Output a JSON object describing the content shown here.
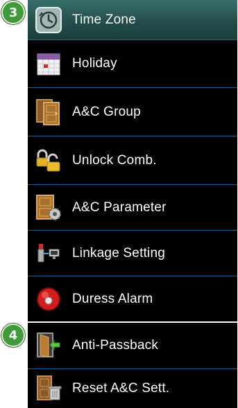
{
  "steps": {
    "first": "3",
    "second": "4"
  },
  "menu": {
    "items": [
      {
        "label": "Time Zone",
        "icon": "clock-icon",
        "selected": true
      },
      {
        "label": "Holiday",
        "icon": "calendar-icon"
      },
      {
        "label": "A&C Group",
        "icon": "double-door-icon"
      },
      {
        "label": "Unlock Comb.",
        "icon": "padlock-pair-icon"
      },
      {
        "label": "A&C Parameter",
        "icon": "door-gear-icon"
      },
      {
        "label": "Linkage Setting",
        "icon": "linkage-icon"
      },
      {
        "label": "Duress Alarm",
        "icon": "alarm-bell-icon"
      },
      {
        "label": "Anti-Passback",
        "icon": "door-arrow-icon"
      },
      {
        "label": "Reset A&C Sett.",
        "icon": "door-trash-icon"
      }
    ]
  },
  "colors": {
    "selected_row": "#2f5f5d",
    "divider": "#1f5f8f",
    "step_badge": "#3f9a3a"
  }
}
